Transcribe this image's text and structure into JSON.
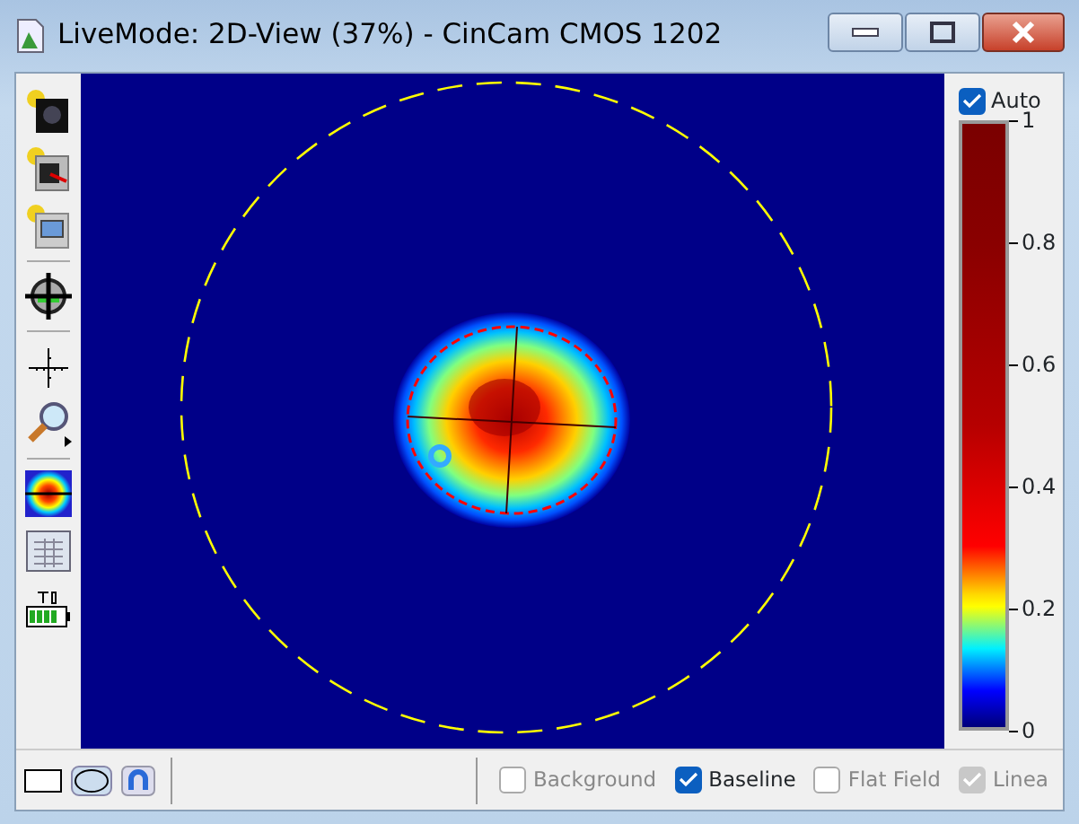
{
  "window": {
    "title": "LiveMode: 2D-View (37%) - CinCam CMOS 1202"
  },
  "colorbar": {
    "auto": {
      "label": "Auto",
      "checked": true
    },
    "ticks": [
      "1",
      "0.8",
      "0.6",
      "0.4",
      "0.2",
      "0"
    ]
  },
  "options": [
    {
      "label": "Background",
      "checked": false,
      "disabled": true
    },
    {
      "label": "Baseline",
      "checked": true,
      "disabled": false
    },
    {
      "label": "Flat Field",
      "checked": false,
      "disabled": true
    },
    {
      "label": "Linea",
      "checked": true,
      "disabled": true
    }
  ]
}
